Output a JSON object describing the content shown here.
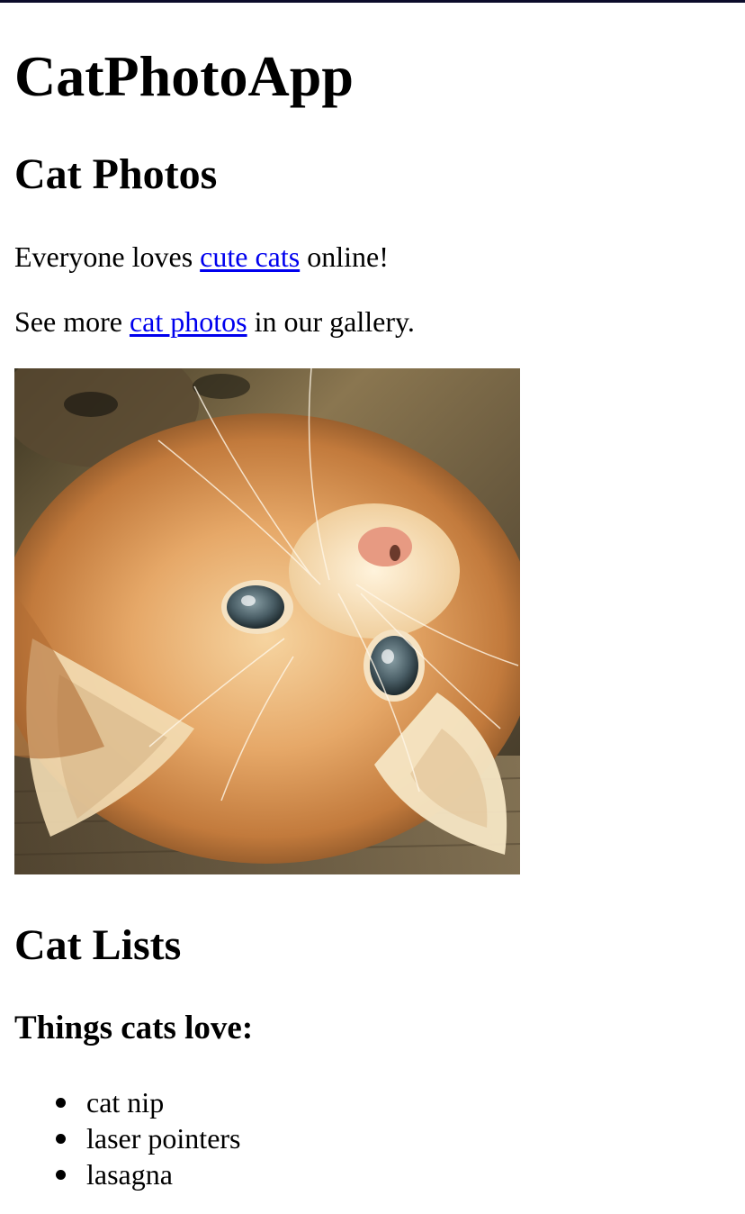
{
  "header": {
    "app_title": "CatPhotoApp"
  },
  "photos_section": {
    "title": "Cat Photos",
    "intro": {
      "before": "Everyone loves ",
      "link_text": "cute cats",
      "after": " online!"
    },
    "gallery": {
      "before": "See more ",
      "link_text": "cat photos",
      "after": " in our gallery."
    },
    "image_subject": "orange kitten lying upside down on wooden floor"
  },
  "lists_section": {
    "title": "Cat Lists",
    "loves_heading": "Things cats love:",
    "loves_items": [
      "cat nip",
      "laser pointers",
      "lasagna"
    ]
  },
  "colors": {
    "link": "#0000ee",
    "text": "#000000",
    "background": "#ffffff"
  }
}
